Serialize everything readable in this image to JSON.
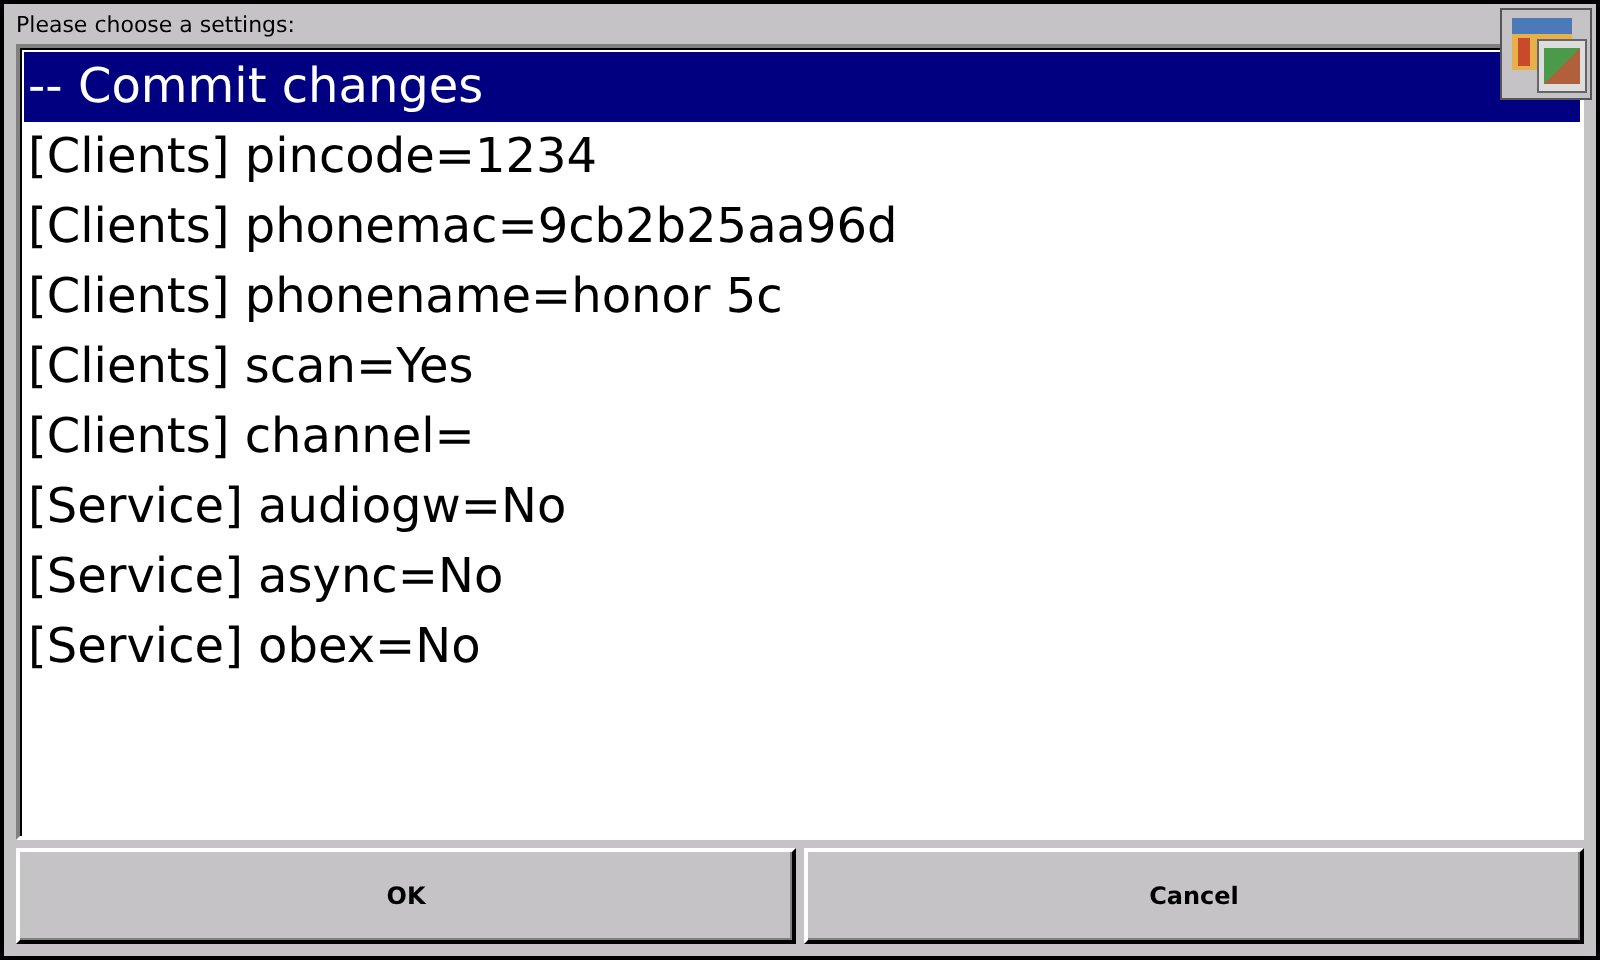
{
  "title": "Please choose a settings:",
  "items": [
    {
      "label": "-- Commit changes",
      "selected": true
    },
    {
      "label": "[Clients] pincode=1234",
      "selected": false
    },
    {
      "label": "[Clients] phonemac=9cb2b25aa96d",
      "selected": false
    },
    {
      "label": "[Clients] phonename=honor 5c",
      "selected": false
    },
    {
      "label": "[Clients] scan=Yes",
      "selected": false
    },
    {
      "label": "[Clients] channel=",
      "selected": false
    },
    {
      "label": "[Service] audiogw=No",
      "selected": false
    },
    {
      "label": "[Service] async=No",
      "selected": false
    },
    {
      "label": "[Service] obex=No",
      "selected": false
    }
  ],
  "buttons": [
    "OK",
    "Cancel"
  ]
}
